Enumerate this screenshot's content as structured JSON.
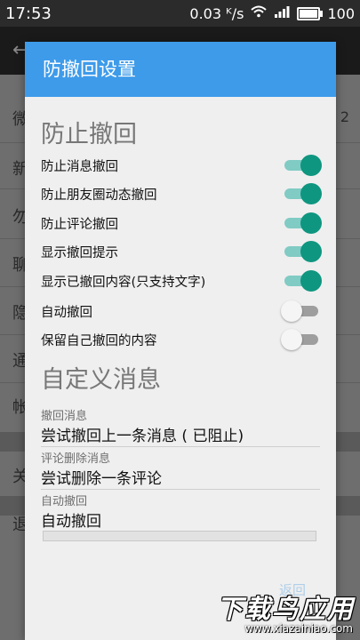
{
  "status_bar": {
    "time": "17:53",
    "network_speed": "0.03 ᴷ/s",
    "battery_level": "100",
    "icons": [
      "wifi-icon",
      "signal-icon",
      "battery-icon"
    ]
  },
  "background_app": {
    "items": [
      "微",
      "新",
      "勿",
      "聊",
      "隐",
      "通",
      "帐",
      "关",
      "退"
    ],
    "right_value": "2"
  },
  "dialog": {
    "title": "防撤回设置",
    "section1_title": "防止撤回",
    "prefs": [
      {
        "label": "防止消息撤回",
        "on": true
      },
      {
        "label": "防止朋友圈动态撤回",
        "on": true
      },
      {
        "label": "防止评论撤回",
        "on": true
      },
      {
        "label": "显示撤回提示",
        "on": true
      },
      {
        "label": "显示已撤回内容(只支持文字)",
        "on": true
      },
      {
        "label": "自动撤回",
        "on": false
      },
      {
        "label": "保留自己撤回的内容",
        "on": false
      }
    ],
    "section2_title": "自定义消息",
    "fields": [
      {
        "label": "撤回消息",
        "value": "尝试撤回上一条消息 ( 已阻止)"
      },
      {
        "label": "评论删除消息",
        "value": "尝试删除一条评论"
      },
      {
        "label": "自动撤回",
        "value": "自动撤回"
      }
    ],
    "button_label": "返回"
  },
  "watermark": {
    "text": "下载鸟应用",
    "url": "www.xiazainiao.com"
  },
  "colors": {
    "title_bar": "#3e9bea",
    "switch_on": "#0e9680",
    "switch_on_track": "#80cbc4"
  }
}
